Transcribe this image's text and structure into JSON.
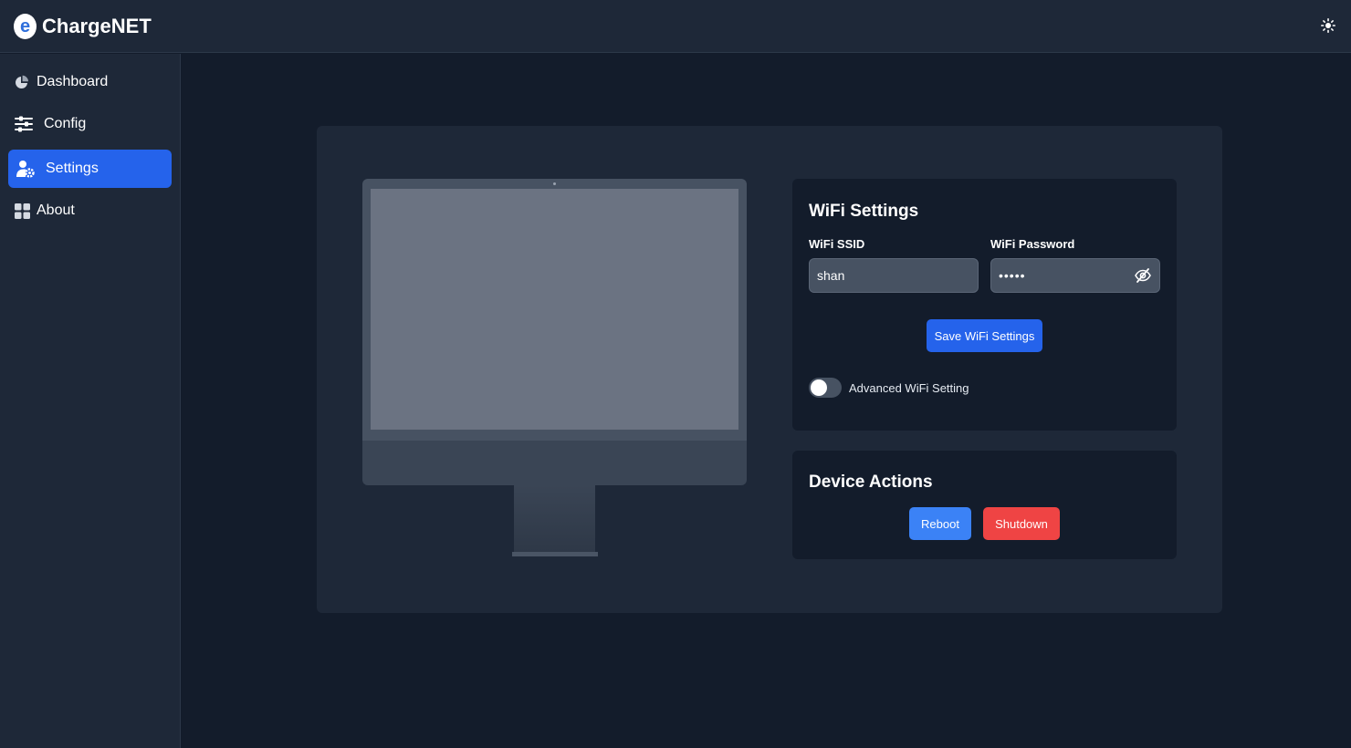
{
  "app": {
    "brand_name": "ChargeNET",
    "logo_letter": "e"
  },
  "header": {
    "theme_icon": "sun-icon"
  },
  "sidebar": {
    "items": [
      {
        "label": "Dashboard",
        "icon": "pie-chart-icon",
        "active": false
      },
      {
        "label": "Config",
        "icon": "sliders-icon",
        "active": false
      },
      {
        "label": "Settings",
        "icon": "user-gear-icon",
        "active": true
      },
      {
        "label": "About",
        "icon": "grid-icon",
        "active": false
      }
    ]
  },
  "wifi": {
    "title": "WiFi Settings",
    "ssid_label": "WiFi SSID",
    "ssid_value": "shan",
    "password_label": "WiFi Password",
    "password_value": "•••••",
    "password_toggle_icon": "eye-slash-icon",
    "save_label": "Save WiFi Settings",
    "advanced_label": "Advanced WiFi Setting",
    "advanced_enabled": false
  },
  "device_actions": {
    "title": "Device Actions",
    "reboot_label": "Reboot",
    "shutdown_label": "Shutdown"
  },
  "colors": {
    "accent": "#2563eb",
    "reboot": "#3b82f6",
    "shutdown": "#ef4444",
    "background": "#131c2b",
    "surface": "#1e2838"
  }
}
